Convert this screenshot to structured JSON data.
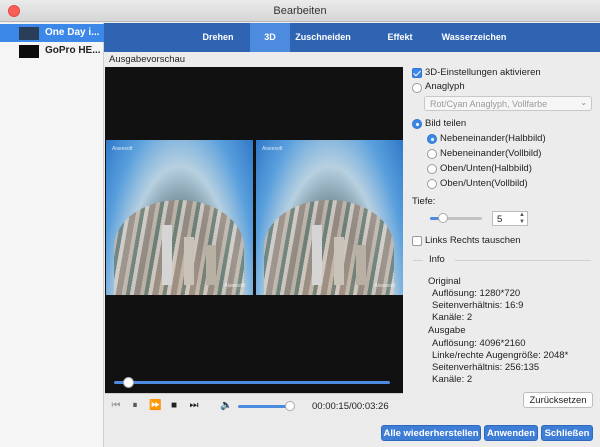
{
  "window": {
    "title": "Bearbeiten"
  },
  "sidebar": {
    "items": [
      {
        "label": "One Day i...",
        "selected": true
      },
      {
        "label": "GoPro HE...",
        "selected": false
      }
    ]
  },
  "tabs": [
    {
      "label": "Drehen",
      "active": false
    },
    {
      "label": "3D",
      "active": true
    },
    {
      "label": "Zuschneiden",
      "active": false
    },
    {
      "label": "Effekt",
      "active": false
    },
    {
      "label": "Wasserzeichen",
      "active": false
    }
  ],
  "preview": {
    "label": "Ausgabevorschau",
    "watermark_tl": "Aiseesoft",
    "watermark_br": "Aiseesoft"
  },
  "player": {
    "timecode": "00:00:15/00:03:26",
    "progress_fraction": 0.05,
    "volume_fraction": 0.9
  },
  "settings": {
    "enable_3d_label": "3D-Einstellungen aktivieren",
    "enable_3d_checked": true,
    "anaglyph_label": "Anaglyph",
    "anaglyph_selected": false,
    "anaglyph_dropdown_value": "Rot/Cyan Anaglyph, Vollfarbe",
    "split_label": "Bild teilen",
    "split_selected": true,
    "split_options": [
      {
        "label": "Nebeneinander(Halbbild)",
        "selected": true
      },
      {
        "label": "Nebeneinander(Vollbild)",
        "selected": false
      },
      {
        "label": "Oben/Unten(Halbbild)",
        "selected": false
      },
      {
        "label": "Oben/Unten(Vollbild)",
        "selected": false
      }
    ],
    "depth_label": "Tiefe:",
    "depth_value": "5",
    "depth_fraction": 0.25,
    "swap_label": "Links Rechts tauschen",
    "swap_checked": false
  },
  "info": {
    "heading": "Info",
    "original_heading": "Original",
    "original_lines": [
      "Auflösung: 1280*720",
      "Seitenverhältnis: 16:9",
      "Kanäle: 2"
    ],
    "output_heading": "Ausgabe",
    "output_lines": [
      "Auflösung: 4096*2160",
      "Linke/rechte Augengröße: 2048*",
      "Seitenverhältnis: 256:135",
      "Kanäle: 2"
    ]
  },
  "buttons": {
    "reset": "Zurücksetzen",
    "restore_all": "Alle wiederherstellen",
    "apply": "Anwenden",
    "close": "Schließen"
  },
  "colors": {
    "tabbar": "#2f64b3",
    "tab_active": "#4d8bdf",
    "accent": "#3c88e8",
    "close_dot": "#fc5f57"
  }
}
